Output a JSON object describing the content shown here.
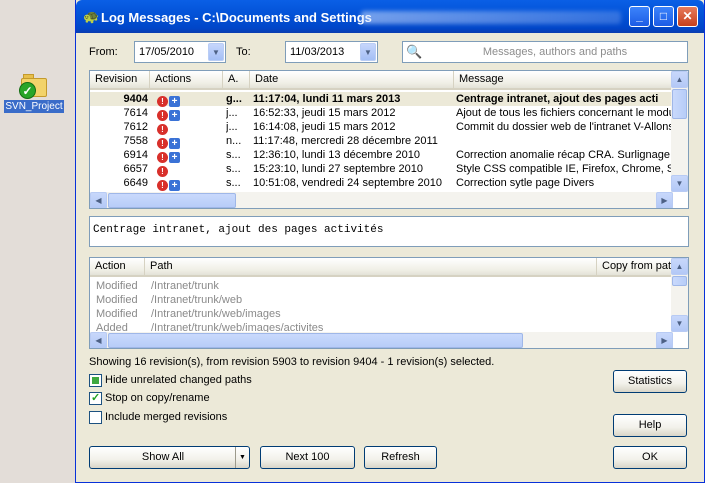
{
  "desktop": {
    "icon_label": "SVN_Project"
  },
  "window": {
    "title": "Log Messages - C:\\Documents and Settings",
    "btn_min": "_",
    "btn_max": "□",
    "btn_close": "✕"
  },
  "filters": {
    "from_label": "From:",
    "from_value": "17/05/2010",
    "to_label": "To:",
    "to_value": "11/03/2013",
    "search_placeholder": "Messages, authors and paths"
  },
  "revisions": {
    "columns": [
      "Revision",
      "Actions",
      "A.",
      "Date",
      "Message"
    ],
    "rows": [
      {
        "revision": "9404",
        "author": "g...",
        "date": "11:17:04, lundi 11 mars 2013",
        "message": "Centrage intranet, ajout des pages acti",
        "selected": true
      },
      {
        "revision": "7614",
        "author": "j...",
        "date": "16:52:33, jeudi 15 mars 2012",
        "message": "Ajout de tous les fichiers concernant le modu"
      },
      {
        "revision": "7612",
        "author": "j...",
        "date": "16:14:08, jeudi 15 mars 2012",
        "message": "Commit du dossier web de l'intranet V-AllonsN"
      },
      {
        "revision": "7558",
        "author": "n...",
        "date": "11:17:48, mercredi 28 décembre 2011",
        "message": ""
      },
      {
        "revision": "6914",
        "author": "s...",
        "date": "12:36:10, lundi 13 décembre 2010",
        "message": "Correction anomalie récap CRA. Surlignage d"
      },
      {
        "revision": "6657",
        "author": "s...",
        "date": "15:23:10, lundi 27 septembre 2010",
        "message": "Style CSS compatible IE, Firefox, Chrome, Sa"
      },
      {
        "revision": "6649",
        "author": "s...",
        "date": "10:51:08, vendredi 24 septembre 2010",
        "message": "Correction sytle page Divers"
      }
    ]
  },
  "message_text": "Centrage intranet, ajout des pages activités",
  "paths": {
    "columns": [
      "Action",
      "Path",
      "Copy from pat"
    ],
    "rows": [
      {
        "action": "Modified",
        "path": "/Intranet/trunk"
      },
      {
        "action": "Modified",
        "path": "/Intranet/trunk/web"
      },
      {
        "action": "Modified",
        "path": "/Intranet/trunk/web/images"
      },
      {
        "action": "Added",
        "path": "/Intranet/trunk/web/images/activites"
      }
    ]
  },
  "status_text": "Showing 16 revision(s), from revision 5903 to revision 9404 - 1 revision(s) selected.",
  "options": {
    "hide_unrelated": "Hide unrelated changed paths",
    "stop_on_copy": "Stop on copy/rename",
    "include_merged": "Include merged revisions"
  },
  "buttons": {
    "show_all": "Show All",
    "next_100": "Next 100",
    "refresh": "Refresh",
    "statistics": "Statistics",
    "help": "Help",
    "ok": "OK"
  }
}
